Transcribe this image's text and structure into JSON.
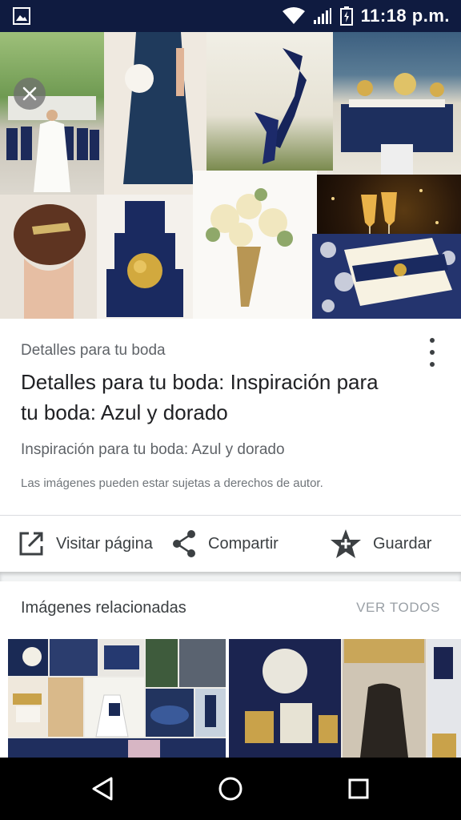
{
  "status_bar": {
    "time": "11:18 p.m.",
    "icons": [
      "gallery-icon",
      "wifi-icon",
      "signal-icon",
      "battery-icon"
    ]
  },
  "hero": {
    "close_icon": "close-icon",
    "tiles": [
      "bridesmaids-photo",
      "navy-dress-photo",
      "navy-shoes-photo",
      "table-setting-photo",
      "champagne-photo",
      "hairstyle-photo",
      "navy-cake-photo",
      "bouquet-photo",
      "invitation-photo"
    ]
  },
  "result": {
    "source": "Detalles para tu boda",
    "title": "Detalles para tu boda: Inspiración para tu boda: Azul y dorado",
    "subtitle": "Inspiración para tu boda: Azul y dorado",
    "copyright": "Las imágenes pueden estar sujetas a derechos de autor."
  },
  "actions": {
    "visit": "Visitar página",
    "share": "Compartir",
    "save": "Guardar"
  },
  "related": {
    "title": "Imágenes relacionadas",
    "see_all": "VER TODOS"
  },
  "colors": {
    "status_bar": "#0f1b40",
    "navy": "#1c2a5a",
    "gold": "#c9a24a",
    "text_primary": "#202124",
    "text_secondary": "#5f6368"
  }
}
